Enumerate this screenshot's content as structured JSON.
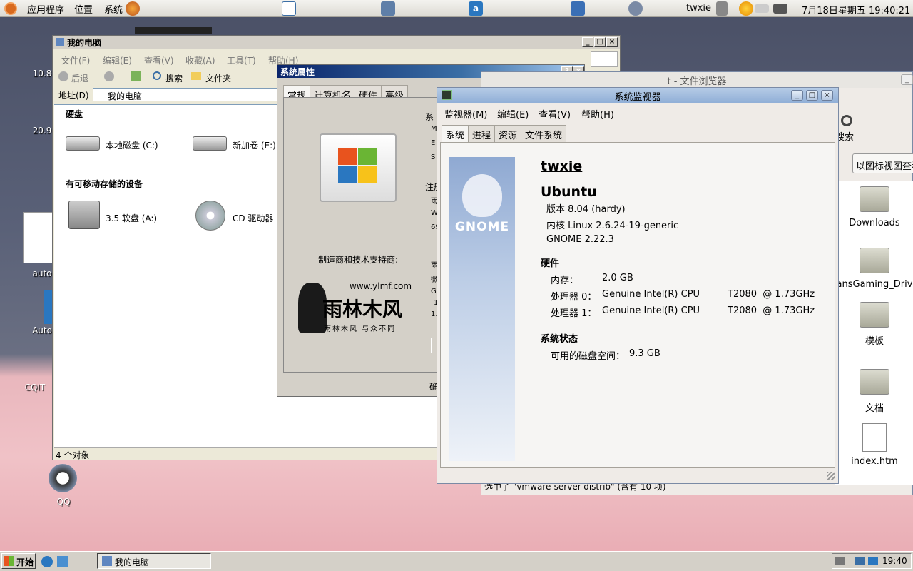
{
  "top_panel": {
    "menus": [
      "应用程序",
      "位置",
      "系统"
    ],
    "user": "twxie",
    "clock": "7月18日星期五 19:40:21"
  },
  "desktop_icons": [
    "10.8",
    "20.9",
    "auto",
    "Auto",
    "CQIT",
    "QQ"
  ],
  "explorer": {
    "title": "我的电脑",
    "menus": [
      "文件(F)",
      "编辑(E)",
      "查看(V)",
      "收藏(A)",
      "工具(T)",
      "帮助(H)"
    ],
    "toolbar": {
      "back": "后退",
      "search": "搜索",
      "folders": "文件夹"
    },
    "address_label": "地址(D)",
    "address_value": "我的电脑",
    "sections": {
      "hard_disks": "硬盘",
      "removable": "有可移动存储的设备"
    },
    "drives": [
      {
        "label": "本地磁盘 (C:)"
      },
      {
        "label": "新加卷 (E:)"
      },
      {
        "label": "3.5 软盘 (A:)"
      },
      {
        "label": "CD 驱动器"
      }
    ],
    "status": "4 个对象"
  },
  "sysprops": {
    "title": "系统属性",
    "tabs": [
      "常规",
      "计算机名",
      "硬件",
      "高级"
    ],
    "partial": [
      "系",
      "M",
      "E",
      "S",
      "注册",
      "雨",
      "W",
      "69",
      "雨",
      "微",
      "G",
      "1",
      "1."
    ],
    "manufacturer_label": "制造商和技术支持商:",
    "logo_url": "www.ylmf.com",
    "logo_name": "雨林木风",
    "logo_slogan": "雨林木风  与众不同",
    "ok_partial": "确"
  },
  "filebrowser": {
    "title": "t - 文件浏览器",
    "search": "搜索",
    "view_select": "以图标视图查看",
    "items": [
      "Downloads",
      "ansGaming_Driv",
      "模板",
      "文档",
      "index.htm"
    ],
    "status": "选中了 \"vmware-server-distrib\" (含有 10 项)"
  },
  "monitor": {
    "title": "系统监视器",
    "menus": [
      "监视器(M)",
      "编辑(E)",
      "查看(V)",
      "帮助(H)"
    ],
    "tabs": [
      "系统",
      "进程",
      "资源",
      "文件系统"
    ],
    "brand": "GNOME",
    "hostname": "twxie",
    "distro": "Ubuntu",
    "version": "版本 8.04 (hardy)",
    "kernel": "内核 Linux 2.6.24-19-generic",
    "gnome": "GNOME 2.22.3",
    "hardware_heading": "硬件",
    "memory_label": "内存：",
    "memory_value": "2.0 GB",
    "cpus": [
      {
        "label": "处理器 0：",
        "name": "Genuine Intel(R) CPU",
        "model": "T2080  @ 1.73GHz"
      },
      {
        "label": "处理器 1：",
        "name": "Genuine Intel(R) CPU",
        "model": "T2080  @ 1.73GHz"
      }
    ],
    "status_heading": "系统状态",
    "disk_label": "可用的磁盘空间：",
    "disk_value": "9.3 GB"
  },
  "taskbar": {
    "start": "开始",
    "task": "我的电脑",
    "clock": "19:40"
  }
}
